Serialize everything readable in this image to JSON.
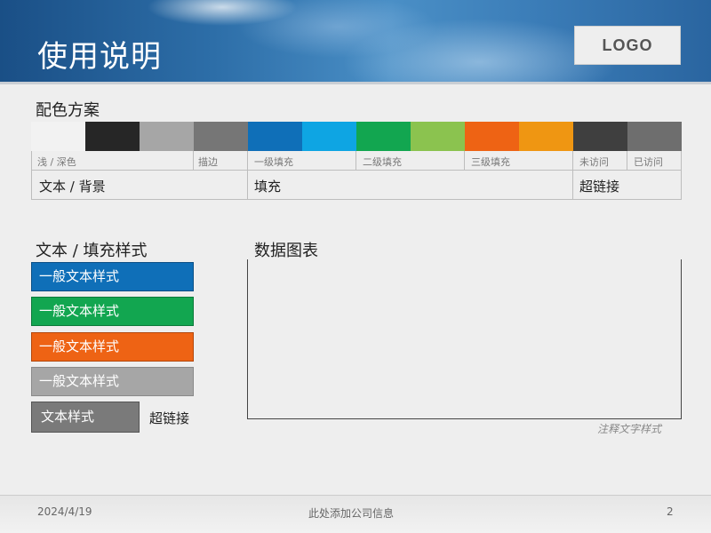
{
  "header": {
    "title": "使用说明",
    "logo_text": "LOGO"
  },
  "palette": {
    "section_title": "配色方案",
    "swatches": [
      {
        "name": "white",
        "color": "#f2f2f2"
      },
      {
        "name": "black",
        "color": "#262626"
      },
      {
        "name": "light-gray",
        "color": "#a6a6a6"
      },
      {
        "name": "dark-gray",
        "color": "#767676"
      },
      {
        "name": "blue-dark",
        "color": "#0f6fb8"
      },
      {
        "name": "blue-light",
        "color": "#0ea5e3"
      },
      {
        "name": "green-dark",
        "color": "#12a650"
      },
      {
        "name": "green-light",
        "color": "#8bc34f"
      },
      {
        "name": "orange",
        "color": "#ee6314"
      },
      {
        "name": "orange-light",
        "color": "#ef9612"
      },
      {
        "name": "charcoal",
        "color": "#3f3f3f"
      },
      {
        "name": "mid-gray",
        "color": "#6e6e6e"
      }
    ],
    "small_labels": {
      "light_dark": "浅 / 深色",
      "stroke": "描边",
      "fill1": "一级填充",
      "fill2": "二级填充",
      "fill3": "三级填充",
      "unvisited": "未访问",
      "visited": "已访问"
    },
    "big_labels": {
      "text_bg": "文本 / 背景",
      "fill": "填充",
      "hyperlink": "超链接"
    }
  },
  "text_styles": {
    "section_title": "文本 / 填充样式",
    "boxes": [
      {
        "label": "一般文本样式",
        "bg": "#0f6fb8",
        "border": "#0a4f86"
      },
      {
        "label": "一般文本样式",
        "bg": "#12a650",
        "border": "#0c7a3a"
      },
      {
        "label": "一般文本样式",
        "bg": "#ee6314",
        "border": "#b3470c"
      },
      {
        "label": "一般文本样式",
        "bg": "#a6a6a6",
        "border": "#8a8a8a"
      }
    ],
    "text_style_label": "文本样式",
    "hyperlink_label": "超链接"
  },
  "chart": {
    "section_title": "数据图表",
    "caption": "注释文字样式"
  },
  "footer": {
    "date": "2024/4/19",
    "center": "此处添加公司信息",
    "page": "2"
  }
}
